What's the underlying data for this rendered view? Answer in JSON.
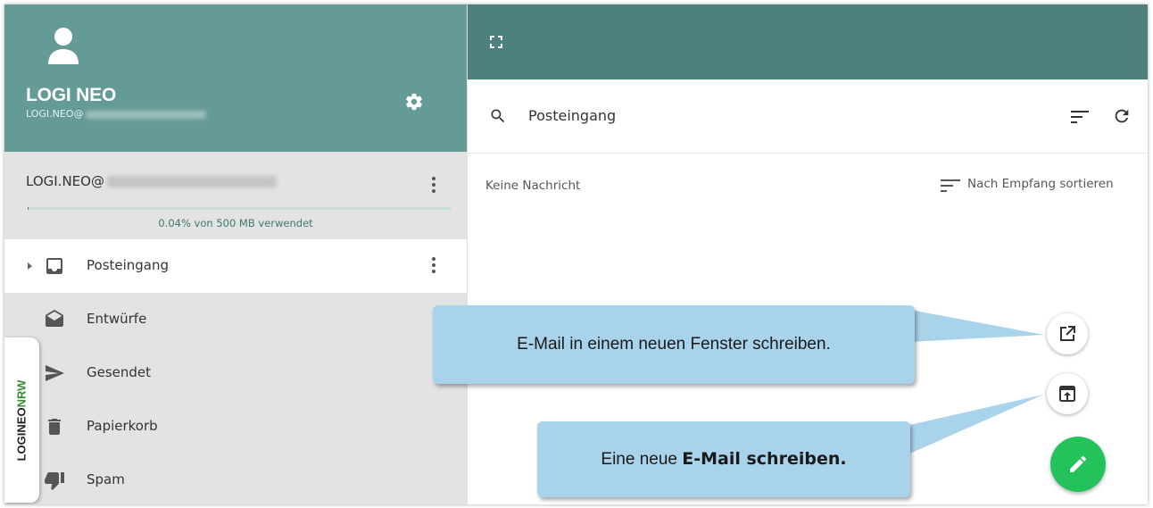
{
  "account": {
    "name": "LOGI NEO",
    "email_prefix": "LOGI.NEO@",
    "mailbox_address_prefix": "LOGI.NEO@",
    "quota_text": "0.04% von 500 MB verwendet",
    "quota_percent": 0.04
  },
  "folders": [
    {
      "label": "Posteingang",
      "icon": "inbox-icon",
      "active": true
    },
    {
      "label": "Entwürfe",
      "icon": "drafts-icon",
      "active": false
    },
    {
      "label": "Gesendet",
      "icon": "send-icon",
      "active": false
    },
    {
      "label": "Papierkorb",
      "icon": "trash-icon",
      "active": false
    },
    {
      "label": "Spam",
      "icon": "thumbs-down-icon",
      "active": false
    }
  ],
  "brand": {
    "logineo": "LOGINEO",
    "nrw": "NRW"
  },
  "mail_list": {
    "search_label": "Posteingang",
    "empty_message": "Keine Nachricht",
    "sort_label": "Nach Empfang sortieren"
  },
  "callouts": {
    "new_window": "E-Mail in einem neuen Fenster schreiben.",
    "compose_prefix": "Eine neue ",
    "compose_bold": "E-Mail schreiben."
  },
  "colors": {
    "sidebar_header": "#659b96",
    "top_bar": "#4d807e",
    "compose_fab": "#23c25b",
    "callout": "#a9d3ea"
  }
}
